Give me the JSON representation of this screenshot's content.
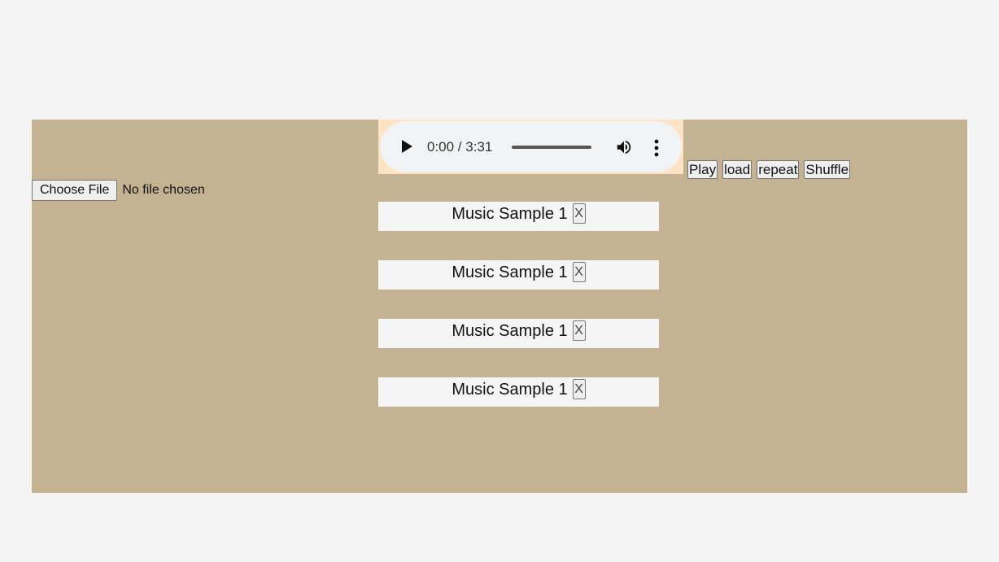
{
  "file_input": {
    "button_label": "Choose File",
    "status": "No file chosen"
  },
  "audio_player": {
    "time_display": "0:00 / 3:31",
    "current_time": "0:00",
    "duration": "3:31",
    "progress": 0,
    "icons": {
      "play": "play-icon",
      "volume": "volume-icon",
      "menu": "more-vertical-icon"
    }
  },
  "controls": {
    "play_label": "Play",
    "load_label": "load",
    "repeat_label": "repeat",
    "shuffle_label": "Shuffle"
  },
  "tracks": [
    {
      "title": "Music Sample 1",
      "remove_label": "X"
    },
    {
      "title": "Music Sample 1",
      "remove_label": "X"
    },
    {
      "title": "Music Sample 1",
      "remove_label": "X"
    },
    {
      "title": "Music Sample 1",
      "remove_label": "X"
    }
  ],
  "colors": {
    "page_background": "#f4f4f4",
    "panel_background": "#c4b393",
    "audio_highlight": "#ffe3c4",
    "track_background": "#f5f5f5"
  }
}
